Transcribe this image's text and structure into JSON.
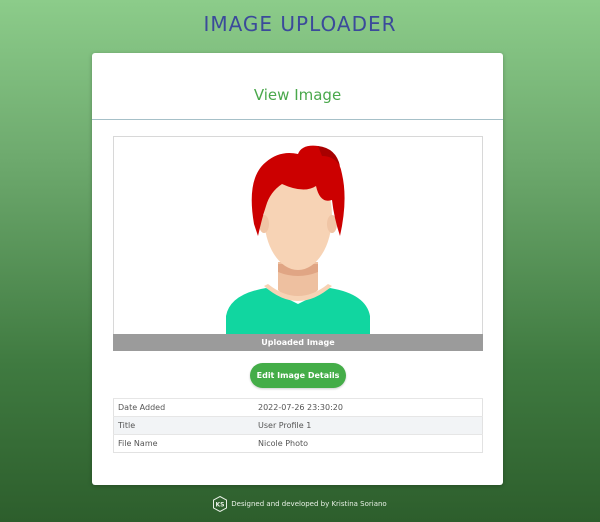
{
  "header": {
    "app_title": "IMAGE UPLOADER"
  },
  "card": {
    "title": "View Image"
  },
  "image": {
    "caption": "Uploaded Image",
    "alt": "avatar illustration of a red-haired person"
  },
  "actions": {
    "edit_label": "Edit Image Details"
  },
  "details": [
    {
      "key": "Date Added",
      "value": "2022-07-26 23:30:20"
    },
    {
      "key": "Title",
      "value": "User Profile 1"
    },
    {
      "key": "File Name",
      "value": "Nicole Photo"
    }
  ],
  "footer": {
    "credit": "Designed and developed by Kristina Soriano",
    "logo_text": "KS"
  },
  "colors": {
    "title": "#3b4a9a",
    "accent": "#44ad48",
    "hair": "#cc0000",
    "skin": "#f7d3b5",
    "shirt": "#11d6a0"
  }
}
